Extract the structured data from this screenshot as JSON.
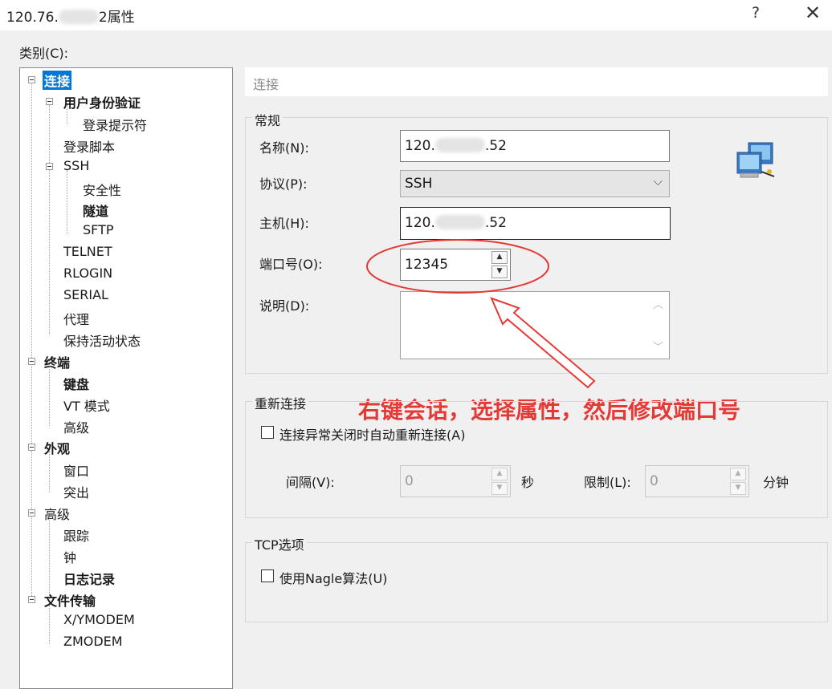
{
  "window": {
    "title_prefix": "120.76.",
    "title_suffix": "2属性",
    "help": "?",
    "close": "✕"
  },
  "category_label": "类别(C):",
  "tree": [
    {
      "label": "连接",
      "bold": true,
      "selected": true
    },
    {
      "label": "用户身份验证",
      "bold": true
    },
    {
      "label": "登录提示符"
    },
    {
      "label": "登录脚本"
    },
    {
      "label": "SSH"
    },
    {
      "label": "安全性"
    },
    {
      "label": "隧道",
      "bold": true
    },
    {
      "label": "SFTP"
    },
    {
      "label": "TELNET"
    },
    {
      "label": "RLOGIN"
    },
    {
      "label": "SERIAL"
    },
    {
      "label": "代理"
    },
    {
      "label": "保持活动状态"
    },
    {
      "label": "终端",
      "bold": true
    },
    {
      "label": "键盘",
      "bold": true
    },
    {
      "label": "VT 模式"
    },
    {
      "label": "高级"
    },
    {
      "label": "外观",
      "bold": true
    },
    {
      "label": "窗口"
    },
    {
      "label": "突出"
    },
    {
      "label": "高级"
    },
    {
      "label": "跟踪"
    },
    {
      "label": "钟"
    },
    {
      "label": "日志记录",
      "bold": true
    },
    {
      "label": "文件传输",
      "bold": true
    },
    {
      "label": "X/YMODEM"
    },
    {
      "label": "ZMODEM"
    }
  ],
  "panel_header": "连接",
  "general": {
    "title": "常规",
    "name_label": "名称(N):",
    "name_prefix": "120.",
    "name_suffix": ".52",
    "protocol_label": "协议(P):",
    "protocol_value": "SSH",
    "host_label": "主机(H):",
    "host_prefix": "120.",
    "host_suffix": ".52",
    "port_label": "端口号(O):",
    "port_value": "12345",
    "desc_label": "说明(D):"
  },
  "reconnect": {
    "title": "重新连接",
    "auto_label": "连接异常关闭时自动重新连接(A)",
    "interval_label": "间隔(V):",
    "interval_value": "0",
    "sec_unit": "秒",
    "limit_label": "限制(L):",
    "limit_value": "0",
    "min_unit": "分钟"
  },
  "tcp": {
    "title": "TCP选项",
    "nagle_label": "使用Nagle算法(U)"
  },
  "annotation": "右键会话，选择属性，然后修改端口号",
  "colors": {
    "annotation": "#e53935",
    "selection": "#0078d7"
  }
}
